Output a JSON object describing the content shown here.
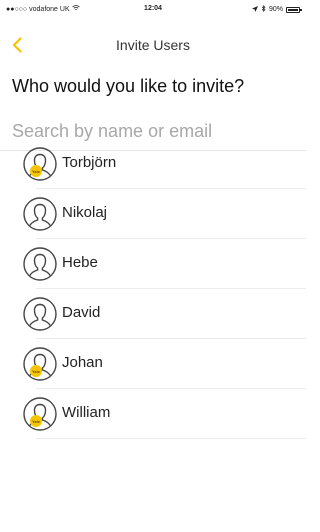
{
  "status_bar": {
    "carrier": "vodafone UK",
    "time": "12:04",
    "battery": "90%"
  },
  "nav": {
    "title": "Invite Users"
  },
  "prompt": "Who would you like to invite?",
  "search": {
    "placeholder": "Search by name or email",
    "value": ""
  },
  "users": [
    {
      "name": "Torbjörn",
      "badge": true
    },
    {
      "name": "Nikolaj",
      "badge": false
    },
    {
      "name": "Hebe",
      "badge": false
    },
    {
      "name": "David",
      "badge": false
    },
    {
      "name": "Johan",
      "badge": true
    },
    {
      "name": "William",
      "badge": true
    }
  ],
  "colors": {
    "accent": "#f5c500",
    "text": "#222222",
    "placeholder": "#a8a8a8"
  }
}
